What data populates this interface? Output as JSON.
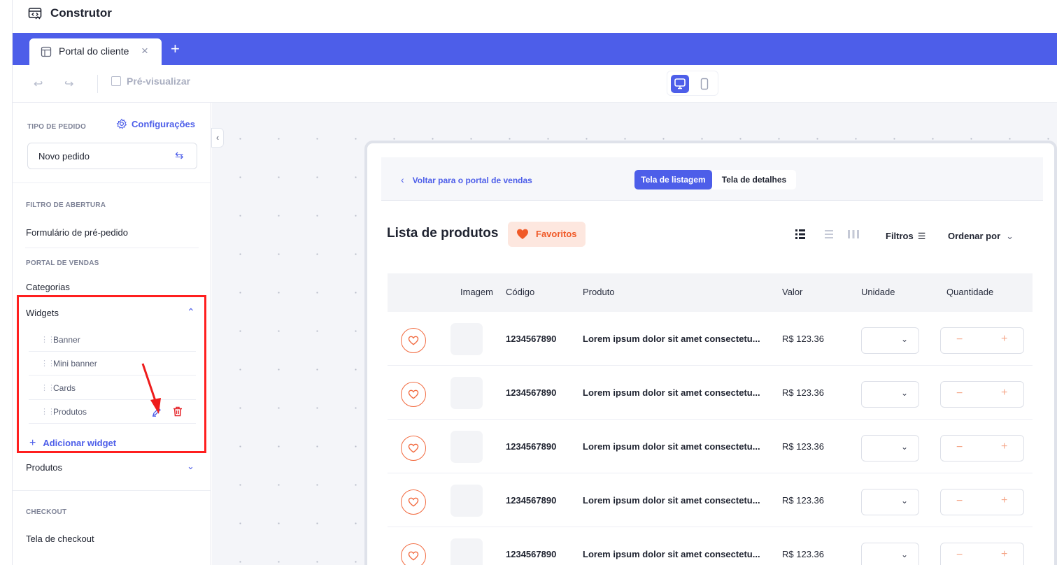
{
  "app": {
    "title": "Construtor"
  },
  "tabs": [
    {
      "label": "Portal do cliente"
    }
  ],
  "toolbar": {
    "preview_label": "Pré-visualizar"
  },
  "sidebar": {
    "order_type_label": "TIPO DE PEDIDO",
    "settings_label": "Configurações",
    "order_type_value": "Novo pedido",
    "opening_filter_label": "FILTRO DE ABERTURA",
    "opening_filter_item": "Formulário de pré-pedido",
    "sales_portal_label": "PORTAL DE VENDAS",
    "categories_label": "Categorias",
    "widgets_label": "Widgets",
    "widgets": [
      "Banner",
      "Mini banner",
      "Cards",
      "Produtos"
    ],
    "add_widget_label": "Adicionar widget",
    "products_label": "Produtos",
    "checkout_label": "CHECKOUT",
    "checkout_item": "Tela de checkout"
  },
  "preview": {
    "back_label": "Voltar para o portal de vendas",
    "tab_list": "Tela de listagem",
    "tab_details": "Tela de detalhes",
    "list_title": "Lista de produtos",
    "favorites_label": "Favoritos",
    "filters_label": "Filtros",
    "sort_label": "Ordenar por",
    "columns": {
      "image": "Imagem",
      "code": "Código",
      "product": "Produto",
      "value": "Valor",
      "unit": "Unidade",
      "quantity": "Quantidade"
    },
    "rows": [
      {
        "code": "1234567890",
        "product": "Lorem ipsum dolor sit amet consectetu...",
        "value": "R$ 123.36"
      },
      {
        "code": "1234567890",
        "product": "Lorem ipsum dolor sit amet consectetu...",
        "value": "R$ 123.36"
      },
      {
        "code": "1234567890",
        "product": "Lorem ipsum dolor sit amet consectetu...",
        "value": "R$ 123.36"
      },
      {
        "code": "1234567890",
        "product": "Lorem ipsum dolor sit amet consectetu...",
        "value": "R$ 123.36"
      },
      {
        "code": "1234567890",
        "product": "Lorem ipsum dolor sit amet consectetu...",
        "value": "R$ 123.36"
      }
    ]
  },
  "colors": {
    "accent": "#4d5ee9",
    "favorite": "#f26a3f",
    "highlight": "#ff1f1f"
  }
}
